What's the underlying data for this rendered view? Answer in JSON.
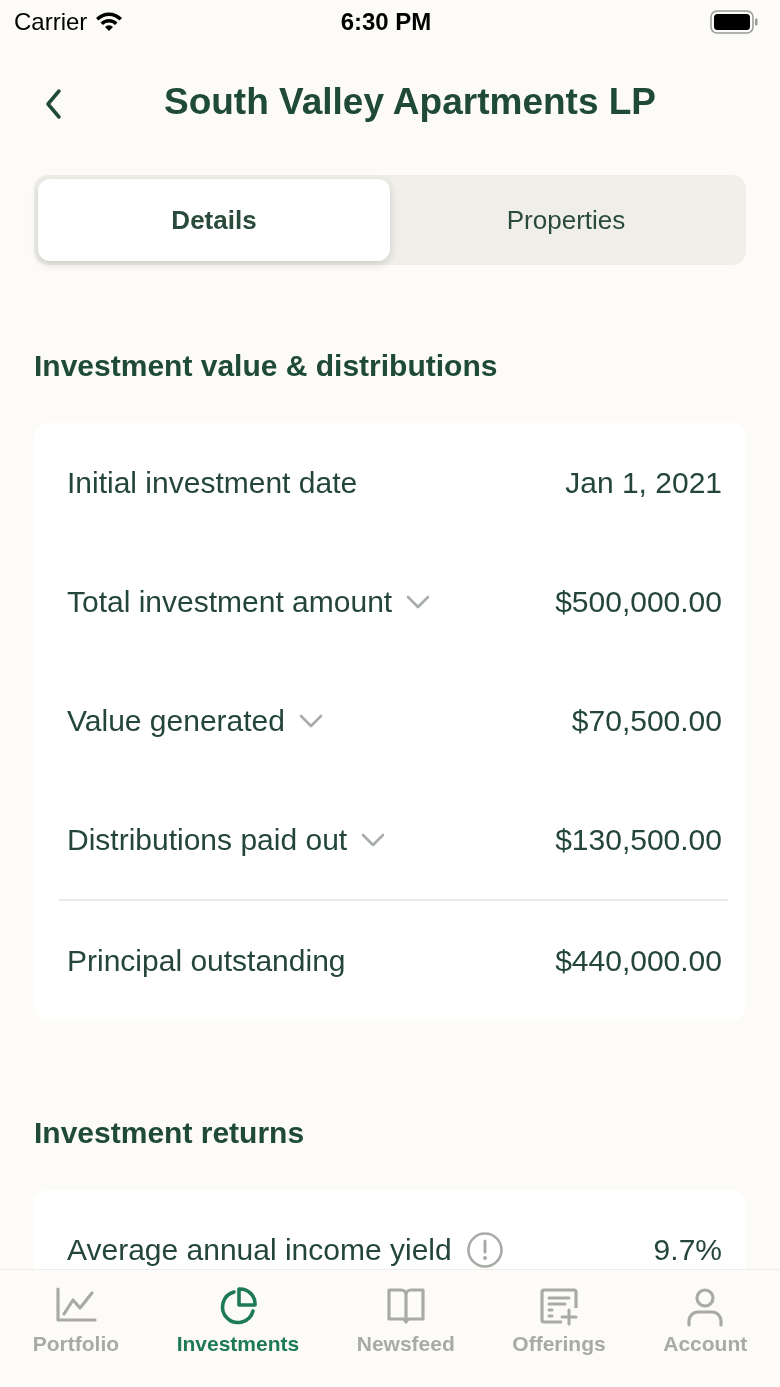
{
  "status_bar": {
    "carrier": "Carrier",
    "time": "6:30 PM"
  },
  "header": {
    "title": "South Valley Apartments LP"
  },
  "segments": [
    {
      "label": "Details",
      "selected": true
    },
    {
      "label": "Properties",
      "selected": false
    }
  ],
  "sections": [
    {
      "title": "Investment value & distributions",
      "rows": [
        {
          "kind": "plain",
          "label": "Initial investment date",
          "value": "Jan 1, 2021",
          "divider_above": false
        },
        {
          "kind": "expandable",
          "label": "Total investment amount",
          "value": "$500,000.00",
          "divider_above": false
        },
        {
          "kind": "expandable",
          "label": "Value generated",
          "value": "$70,500.00",
          "divider_above": false
        },
        {
          "kind": "expandable",
          "label": "Distributions paid out",
          "value": "$130,500.00",
          "divider_above": false
        },
        {
          "kind": "plain",
          "label": "Principal outstanding",
          "value": "$440,000.00",
          "divider_above": true
        }
      ]
    },
    {
      "title": "Investment returns",
      "rows": [
        {
          "kind": "info",
          "label": "Average annual income yield",
          "value": "9.7%",
          "divider_above": false
        }
      ]
    }
  ],
  "tab_bar": [
    {
      "kind": "chart",
      "label": "Portfolio",
      "selected": false
    },
    {
      "kind": "pie",
      "label": "Investments",
      "selected": true
    },
    {
      "kind": "book",
      "label": "Newsfeed",
      "selected": false
    },
    {
      "kind": "offerings",
      "label": "Offerings",
      "selected": false
    },
    {
      "kind": "person",
      "label": "Account",
      "selected": false
    }
  ]
}
